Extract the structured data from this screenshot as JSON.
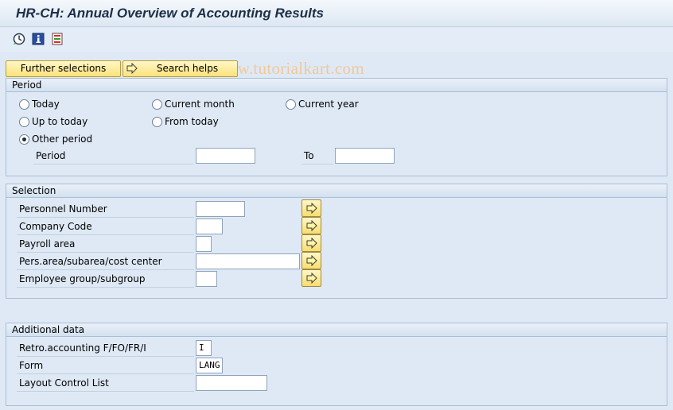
{
  "window": {
    "title": "HR-CH: Annual Overview of Accounting Results"
  },
  "toolbar": {
    "icons": [
      "execute-icon",
      "info-icon",
      "selection-options-icon"
    ],
    "watermark": "© www.tutorialkart.com"
  },
  "buttons": {
    "further_selections": "Further selections",
    "search_helps": "Search helps"
  },
  "period": {
    "header": "Period",
    "options": {
      "today": "Today",
      "current_month": "Current month",
      "current_year": "Current year",
      "up_to_today": "Up to today",
      "from_today": "From today",
      "other_period": "Other period"
    },
    "selected": "other_period",
    "period_label": "Period",
    "period_from": "",
    "to_label": "To",
    "period_to": ""
  },
  "selection": {
    "header": "Selection",
    "fields": [
      {
        "label": "Personnel Number",
        "value": ""
      },
      {
        "label": "Company Code",
        "value": ""
      },
      {
        "label": "Payroll area",
        "value": ""
      },
      {
        "label": "Pers.area/subarea/cost center",
        "value": ""
      },
      {
        "label": "Employee group/subgroup",
        "value": ""
      }
    ]
  },
  "additional": {
    "header": "Additional data",
    "fields": [
      {
        "label": "Retro.accounting F/FO/FR/I",
        "value": "I"
      },
      {
        "label": "Form",
        "value": "LANG"
      },
      {
        "label": "Layout Control List",
        "value": ""
      }
    ]
  },
  "colors": {
    "background": "#dfe9f5",
    "button_yellow": "#fbe27a",
    "title_text": "#1c2f48"
  }
}
